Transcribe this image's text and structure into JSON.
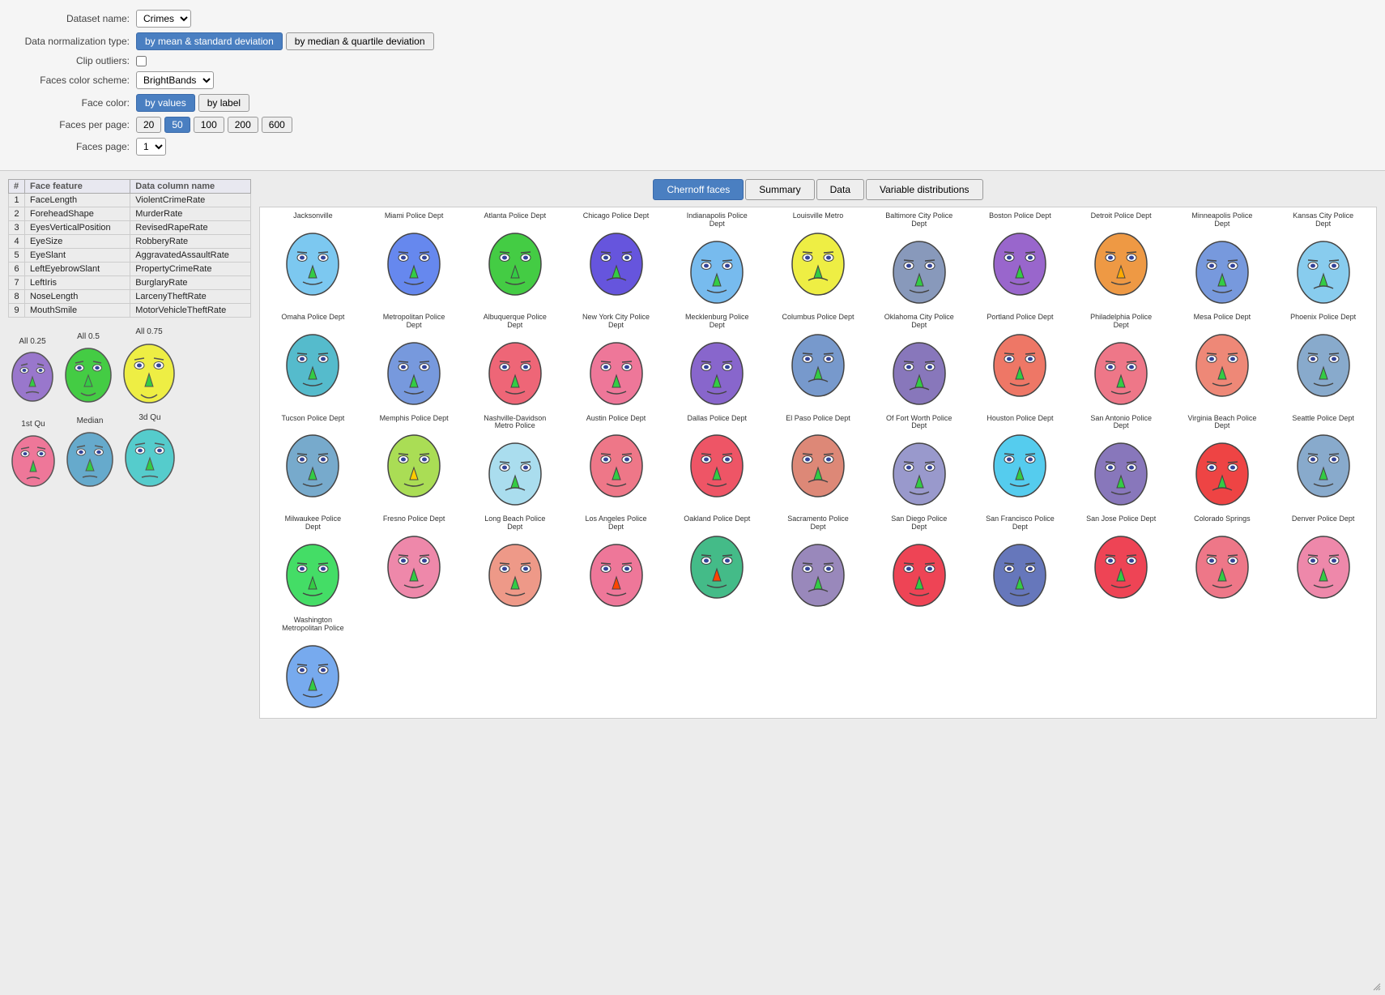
{
  "header": {
    "dataset_label": "Dataset name:",
    "dataset_value": "Crimes",
    "normalization_label": "Data normalization type:",
    "norm_btn1": "by mean & standard deviation",
    "norm_btn2": "by median & quartile deviation",
    "clip_label": "Clip outliers:",
    "color_scheme_label": "Faces color scheme:",
    "color_scheme_value": "BrightBands",
    "face_color_label": "Face color:",
    "face_color_btn1": "by values",
    "face_color_btn2": "by label",
    "faces_per_page_label": "Faces per page:",
    "fpp_options": [
      "20",
      "50",
      "100",
      "200",
      "600"
    ],
    "fpp_active": "50",
    "faces_page_label": "Faces page:",
    "faces_page_value": "1"
  },
  "tabs": [
    "Chernoff faces",
    "Summary",
    "Data",
    "Variable distributions"
  ],
  "active_tab": "Chernoff faces",
  "feature_table": {
    "headers": [
      "#",
      "Face feature",
      "Data column name"
    ],
    "rows": [
      [
        "1",
        "FaceLength",
        "ViolentCrimeRate"
      ],
      [
        "2",
        "ForeheadShape",
        "MurderRate"
      ],
      [
        "3",
        "EyesVerticalPosition",
        "RevisedRapeRate"
      ],
      [
        "4",
        "EyeSize",
        "RobberyRate"
      ],
      [
        "5",
        "EyeSlant",
        "AggravatedAssaultRate"
      ],
      [
        "6",
        "LeftEyebrowSlant",
        "PropertyCrimeRate"
      ],
      [
        "7",
        "LeftIris",
        "BurglaryRate"
      ],
      [
        "8",
        "NoseLength",
        "LarcenyTheftRate"
      ],
      [
        "9",
        "MouthSmile",
        "MotorVehicleTheftRate"
      ]
    ]
  },
  "sample_faces": {
    "row1_labels": [
      "All 0.25",
      "All 0.5",
      "All 0.75"
    ],
    "row2_labels": [
      "1st Qu",
      "Median",
      "3d Qu"
    ]
  },
  "faces": [
    {
      "city": "Jacksonville",
      "color": "#7cc8f0",
      "row": 1
    },
    {
      "city": "Miami Police Dept",
      "color": "#66aaee",
      "row": 1
    },
    {
      "city": "Atlanta Police Dept",
      "color": "#44cc44",
      "row": 1
    },
    {
      "city": "Chicago Police Dept",
      "color": "#6688ee",
      "row": 1
    },
    {
      "city": "Indianapolis Police Dept",
      "color": "#66bbee",
      "row": 1
    },
    {
      "city": "Louisville Metro",
      "color": "#eeee44",
      "row": 1
    },
    {
      "city": "Baltimore City Police Dept",
      "color": "#88aadd",
      "row": 1
    },
    {
      "city": "Boston Police Dept",
      "color": "#9966dd",
      "row": 1
    },
    {
      "city": "Detroit Police Dept",
      "color": "#ee9944",
      "row": 1
    },
    {
      "city": "Minneapolis Police Dept",
      "color": "#6699cc",
      "row": 1
    },
    {
      "city": "Kansas City Police Dept",
      "color": "#88ccee",
      "row": 1
    },
    {
      "city": "Omaha Police Dept",
      "color": "#55bbcc",
      "row": 1
    },
    {
      "city": "Metropolitan Police Dept",
      "color": "#88aaee",
      "row": 1
    },
    {
      "city": "Albuquerque Police Dept",
      "color": "#ee6677",
      "row": 1
    },
    {
      "city": "New York City Police Dept",
      "color": "#ee7799",
      "row": 1
    },
    {
      "city": "Mecklenburg Police Dept",
      "color": "#8877cc",
      "row": 1
    },
    {
      "city": "Columbus Police Dept",
      "color": "#7799cc",
      "row": 1
    },
    {
      "city": "Oklahoma City Police Dept",
      "color": "#8888cc",
      "row": 1
    },
    {
      "city": "Portland Police Dept",
      "color": "#ee7766",
      "row": 1
    },
    {
      "city": "Philadelphia Police Dept",
      "color": "#ee7788",
      "row": 1
    },
    {
      "city": "Mesa Police Dept",
      "color": "#ee7766",
      "row": 1
    },
    {
      "city": "Phoenix Police Dept",
      "color": "#88aacc",
      "row": 1
    },
    {
      "city": "Tucson Police Dept",
      "color": "#7799bb",
      "row": 1
    },
    {
      "city": "Memphis Police Dept",
      "color": "#aadd55",
      "row": 1
    },
    {
      "city": "Nashville-Davidson Metro Police",
      "color": "#aaddee",
      "row": 1
    },
    {
      "city": "Austin Police Dept",
      "color": "#ee7788",
      "row": 1
    },
    {
      "city": "Dallas Police Dept",
      "color": "#ee5566",
      "row": 1
    },
    {
      "city": "El Paso Police Dept",
      "color": "#ee8877",
      "row": 1
    },
    {
      "city": "Of Fort Worth Police Dept",
      "color": "#99aacc",
      "row": 1
    },
    {
      "city": "Houston Police Dept",
      "color": "#55ccee",
      "row": 1
    },
    {
      "city": "San Antonio Police Dept",
      "color": "#8888cc",
      "row": 1
    },
    {
      "city": "Virginia Beach Police Dept",
      "color": "#ee4444",
      "row": 1
    },
    {
      "city": "Seattle Police Dept",
      "color": "#88aacc",
      "row": 1
    },
    {
      "city": "Milwaukee Police Dept",
      "color": "#44dd66",
      "row": 1
    },
    {
      "city": "Fresno Police Dept",
      "color": "#ee88aa",
      "row": 1
    },
    {
      "city": "Long Beach Police Dept",
      "color": "#ee9988",
      "row": 1
    },
    {
      "city": "Los Angeles Police Dept",
      "color": "#ee7799",
      "row": 1
    },
    {
      "city": "Oakland Police Dept",
      "color": "#55bb88",
      "row": 1
    },
    {
      "city": "Sacramento Police Dept",
      "color": "#9988cc",
      "row": 1
    },
    {
      "city": "San Diego Police Dept",
      "color": "#ee4455",
      "row": 1
    },
    {
      "city": "San Francisco Police Dept",
      "color": "#6677bb",
      "row": 1
    },
    {
      "city": "San Jose Police Dept",
      "color": "#ee4455",
      "row": 1
    },
    {
      "city": "Colorado Springs",
      "color": "#ee7788",
      "row": 1
    },
    {
      "city": "Denver Police Dept",
      "color": "#ee88aa",
      "row": 1
    },
    {
      "city": "Washington Metropolitan Police",
      "color": "#77bbee",
      "row": 1
    }
  ]
}
